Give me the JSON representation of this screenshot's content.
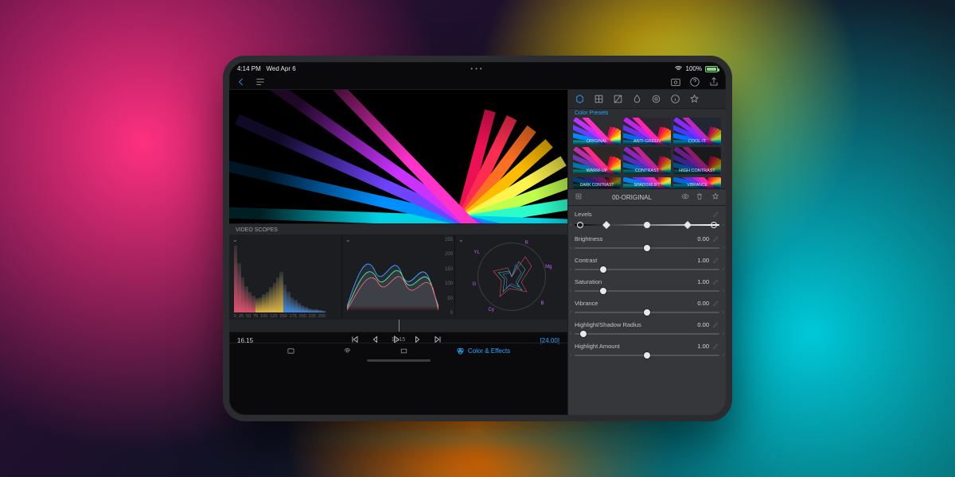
{
  "status": {
    "time": "4:14 PM",
    "date": "Wed Apr 6",
    "battery_pct": "100%",
    "wifi": true
  },
  "scopes_title": "VIDEO SCOPES",
  "histogram_xticks": [
    "0",
    "25",
    "50",
    "75",
    "100",
    "125",
    "150",
    "175",
    "200",
    "225",
    "255"
  ],
  "waveform_yticks": [
    "255",
    "200",
    "150",
    "100",
    "50",
    "0"
  ],
  "vectorscope_tags": [
    "R",
    "Mg",
    "B",
    "Cy",
    "G",
    "YL"
  ],
  "timecode_left": "16.15",
  "timecode_center": "16.15",
  "timecode_right": "[24.00]",
  "bottom_tabs": {
    "color_effects": "Color & Effects"
  },
  "panel": {
    "presets_title": "Color Presets",
    "presets": [
      "ORIGINAL",
      "ANTI-GREEN",
      "COOL-IT",
      "WARM-UP",
      "CONTRAST",
      "HIGH CONTRAST",
      "DARK CONTRAST",
      "SHADOWLIFT",
      "VIBRANCE"
    ],
    "selected": "00-ORIGINAL",
    "sliders": [
      {
        "name": "Levels",
        "type": "levels"
      },
      {
        "name": "Brightness",
        "value": "0.00",
        "pos": 50
      },
      {
        "name": "Contrast",
        "value": "1.00",
        "pos": 20
      },
      {
        "name": "Saturation",
        "value": "1.00",
        "pos": 20
      },
      {
        "name": "Vibrance",
        "value": "0.00",
        "pos": 50
      },
      {
        "name": "Highlight/Shadow Radius",
        "value": "0.00",
        "pos": 6
      },
      {
        "name": "Highlight Amount",
        "value": "1.00",
        "pos": 50
      }
    ]
  },
  "ray_colors": [
    "#e01050",
    "#ff2a4d",
    "#ff6a1f",
    "#ffb300",
    "#ffe84a",
    "#b8ff4a",
    "#2af0c0",
    "#00c8d8",
    "#0088ff",
    "#6a40ff",
    "#c030ff",
    "#ff30c0"
  ]
}
